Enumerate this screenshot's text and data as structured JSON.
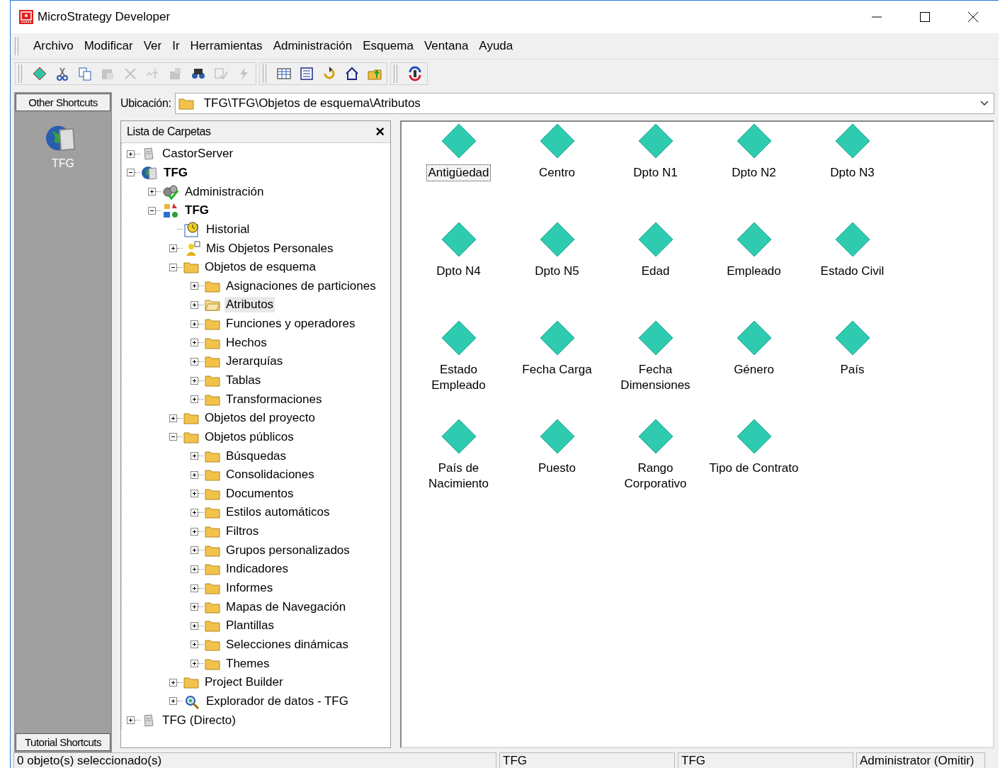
{
  "window": {
    "title": "MicroStrategy Developer"
  },
  "menu": [
    "Archivo",
    "Modificar",
    "Ver",
    "Ir",
    "Herramientas",
    "Administración",
    "Esquema",
    "Ventana",
    "Ayuda"
  ],
  "toolbar": [
    [
      {
        "kind": "new-object",
        "disabled": false
      },
      {
        "kind": "cut",
        "disabled": false
      },
      {
        "kind": "copy",
        "disabled": false
      },
      {
        "kind": "paste",
        "disabled": true
      },
      {
        "kind": "delete",
        "disabled": true
      },
      {
        "kind": "rename",
        "disabled": true
      },
      {
        "kind": "properties",
        "disabled": true
      },
      {
        "kind": "find",
        "disabled": false
      },
      {
        "kind": "check",
        "disabled": true
      },
      {
        "kind": "run",
        "disabled": true
      }
    ],
    [
      {
        "kind": "view",
        "disabled": false
      },
      {
        "kind": "folder-list",
        "disabled": false
      },
      {
        "kind": "refresh",
        "disabled": false
      },
      {
        "kind": "home",
        "disabled": false
      },
      {
        "kind": "up",
        "disabled": false
      }
    ],
    [
      {
        "kind": "sync",
        "disabled": false
      }
    ]
  ],
  "shortcuts": {
    "top_button": "Other Shortcuts",
    "items": [
      {
        "label": "TFG"
      }
    ],
    "bottom_button": "Tutorial Shortcuts"
  },
  "location": {
    "label": "Ubicación:",
    "value": "TFG\\TFG\\Objetos de esquema\\Atributos"
  },
  "folder_list": {
    "title": "Lista de Carpetas",
    "close": "×",
    "items": [
      {
        "label": "CastorServer",
        "kind": "server",
        "expanded": false,
        "bold": false,
        "selected": false
      },
      {
        "label": "TFG",
        "kind": "globe-server",
        "expanded": true,
        "bold": true,
        "selected": false,
        "children": [
          {
            "label": "Administración",
            "kind": "admin",
            "expanded": false,
            "bold": false,
            "selected": false
          },
          {
            "label": "TFG",
            "kind": "project",
            "expanded": true,
            "bold": true,
            "selected": false,
            "children": [
              {
                "label": "Historial",
                "kind": "history",
                "bold": false,
                "selected": false
              },
              {
                "label": "Mis Objetos Personales",
                "kind": "personal",
                "expanded": false,
                "bold": false,
                "selected": false
              },
              {
                "label": "Objetos de esquema",
                "kind": "folder",
                "expanded": true,
                "bold": false,
                "selected": false,
                "children": [
                  {
                    "label": "Asignaciones de particiones",
                    "kind": "folder",
                    "expanded": false,
                    "bold": false,
                    "selected": false
                  },
                  {
                    "label": "Atributos",
                    "kind": "open-folder",
                    "expanded": false,
                    "bold": false,
                    "selected": true
                  },
                  {
                    "label": "Funciones y operadores",
                    "kind": "folder",
                    "expanded": false,
                    "bold": false,
                    "selected": false
                  },
                  {
                    "label": "Hechos",
                    "kind": "folder",
                    "expanded": false,
                    "bold": false,
                    "selected": false
                  },
                  {
                    "label": "Jerarquías",
                    "kind": "folder",
                    "expanded": false,
                    "bold": false,
                    "selected": false
                  },
                  {
                    "label": "Tablas",
                    "kind": "folder",
                    "expanded": false,
                    "bold": false,
                    "selected": false
                  },
                  {
                    "label": "Transformaciones",
                    "kind": "folder",
                    "expanded": false,
                    "bold": false,
                    "selected": false
                  }
                ]
              },
              {
                "label": "Objetos del proyecto",
                "kind": "folder",
                "expanded": false,
                "bold": false,
                "selected": false
              },
              {
                "label": "Objetos públicos",
                "kind": "folder",
                "expanded": true,
                "bold": false,
                "selected": false,
                "children": [
                  {
                    "label": "Búsquedas",
                    "kind": "folder",
                    "expanded": false,
                    "bold": false,
                    "selected": false
                  },
                  {
                    "label": "Consolidaciones",
                    "kind": "folder",
                    "expanded": false,
                    "bold": false,
                    "selected": false
                  },
                  {
                    "label": "Documentos",
                    "kind": "folder",
                    "expanded": false,
                    "bold": false,
                    "selected": false
                  },
                  {
                    "label": "Estilos automáticos",
                    "kind": "folder",
                    "expanded": false,
                    "bold": false,
                    "selected": false
                  },
                  {
                    "label": "Filtros",
                    "kind": "folder",
                    "expanded": false,
                    "bold": false,
                    "selected": false
                  },
                  {
                    "label": "Grupos personalizados",
                    "kind": "folder",
                    "expanded": false,
                    "bold": false,
                    "selected": false
                  },
                  {
                    "label": "Indicadores",
                    "kind": "folder",
                    "expanded": false,
                    "bold": false,
                    "selected": false
                  },
                  {
                    "label": "Informes",
                    "kind": "folder",
                    "expanded": false,
                    "bold": false,
                    "selected": false
                  },
                  {
                    "label": "Mapas de Navegación",
                    "kind": "folder",
                    "expanded": false,
                    "bold": false,
                    "selected": false
                  },
                  {
                    "label": "Plantillas",
                    "kind": "folder",
                    "expanded": false,
                    "bold": false,
                    "selected": false
                  },
                  {
                    "label": "Selecciones dinámicas",
                    "kind": "folder",
                    "expanded": false,
                    "bold": false,
                    "selected": false
                  },
                  {
                    "label": "Themes",
                    "kind": "folder",
                    "expanded": false,
                    "bold": false,
                    "selected": false
                  }
                ]
              },
              {
                "label": "Project Builder",
                "kind": "folder",
                "expanded": false,
                "bold": false,
                "selected": false
              },
              {
                "label": "Explorador de datos - TFG",
                "kind": "explorer",
                "expanded": false,
                "bold": false,
                "selected": false
              }
            ]
          }
        ]
      },
      {
        "label": "TFG (Directo)",
        "kind": "server",
        "expanded": false,
        "bold": false,
        "selected": false
      }
    ]
  },
  "objects": [
    {
      "label": "Antigüedad",
      "selected": true
    },
    {
      "label": "Centro",
      "selected": false
    },
    {
      "label": "Dpto N1",
      "selected": false
    },
    {
      "label": "Dpto N2",
      "selected": false
    },
    {
      "label": "Dpto N3",
      "selected": false
    },
    {
      "label": "Dpto N4",
      "selected": false
    },
    {
      "label": "Dpto N5",
      "selected": false
    },
    {
      "label": "Edad",
      "selected": false
    },
    {
      "label": "Empleado",
      "selected": false
    },
    {
      "label": "Estado Civil",
      "selected": false
    },
    {
      "label": "Estado\nEmpleado",
      "selected": false
    },
    {
      "label": "Fecha Carga",
      "selected": false
    },
    {
      "label": "Fecha\nDimensiones",
      "selected": false
    },
    {
      "label": "Género",
      "selected": false
    },
    {
      "label": "País",
      "selected": false
    },
    {
      "label": "País de\nNacimiento",
      "selected": false
    },
    {
      "label": "Puesto",
      "selected": false
    },
    {
      "label": "Rango\nCorporativo",
      "selected": false
    },
    {
      "label": "Tipo de Contrato",
      "selected": false
    }
  ],
  "status_bar": [
    "0 objeto(s) seleccionado(s)",
    "TFG",
    "TFG",
    "Administrator (Omitir)"
  ]
}
